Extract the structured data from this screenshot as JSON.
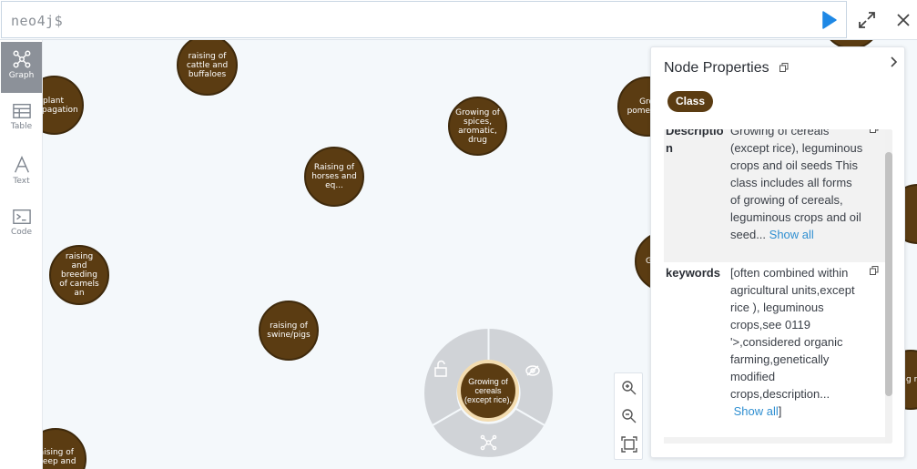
{
  "query": {
    "prompt": "neo4j$"
  },
  "sidebar": {
    "items": [
      {
        "label": "Graph",
        "active": true
      },
      {
        "label": "Table",
        "active": false
      },
      {
        "label": "Text",
        "active": false
      },
      {
        "label": "Code",
        "active": false
      }
    ]
  },
  "graph": {
    "node_color": "#5b3c12",
    "nodes": [
      "raising of cattle and buffaloes",
      "plant propagation",
      "Growing of spices, aromatic, drug",
      "Raising of horses and eq...",
      "raising and breeding of camels an",
      "raising of swine/pigs",
      "raising of sheep and",
      "Growi pome and s",
      "G",
      "g ro"
    ],
    "selected_node": "Growing of cereals (except rice),"
  },
  "properties": {
    "title": "Node Properties",
    "label_badge": "Class",
    "rows": [
      {
        "key": "Descriptio n",
        "value": "Growing of cereals (except rice), leguminous crops and oil seeds This class includes all forms of growing of cereals, leguminous crops and oil seed...",
        "show_all": "Show all"
      },
      {
        "key": "keywords",
        "value": "[often combined within agricultural units,except rice ), leguminous crops,see 0119 '>,considered organic farming,genetically modified crops,description...",
        "show_all": "Show all",
        "suffix": "]"
      }
    ]
  }
}
